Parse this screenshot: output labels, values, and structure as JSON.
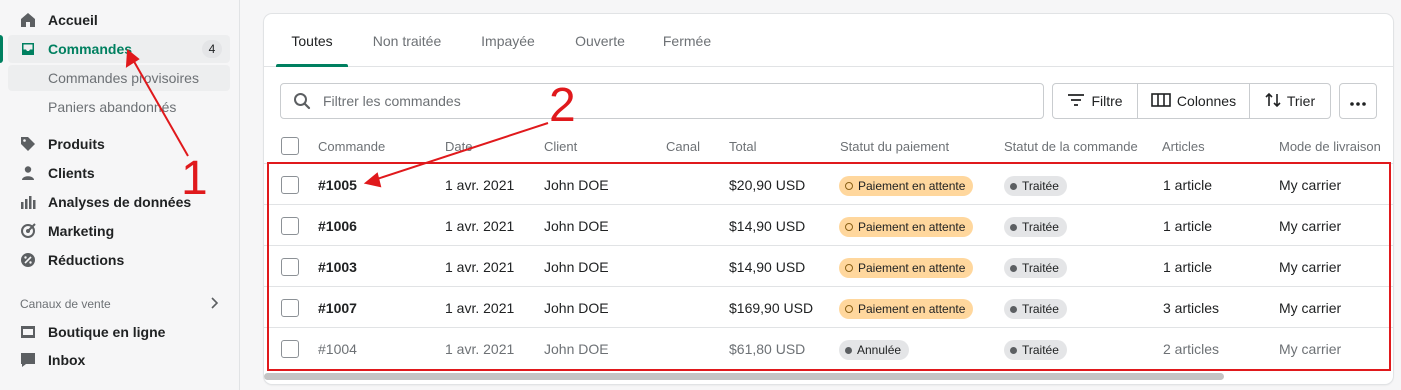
{
  "sidebar": {
    "items": [
      {
        "label": "Accueil",
        "icon": "home-icon"
      },
      {
        "label": "Commandes",
        "icon": "inbox-tray-icon",
        "badge": "4",
        "active": true
      },
      {
        "label": "Produits",
        "icon": "tag-icon"
      },
      {
        "label": "Clients",
        "icon": "person-icon"
      },
      {
        "label": "Analyses de données",
        "icon": "bar-chart-icon"
      },
      {
        "label": "Marketing",
        "icon": "target-icon"
      },
      {
        "label": "Réductions",
        "icon": "discount-icon"
      }
    ],
    "subitems": [
      "Commandes provisoires",
      "Paniers abandonnés"
    ],
    "sales_channels_title": "Canaux de vente",
    "channels": [
      {
        "label": "Boutique en ligne",
        "icon": "store-icon"
      },
      {
        "label": "Inbox",
        "icon": "chat-icon"
      }
    ]
  },
  "tabs": [
    "Toutes",
    "Non traitée",
    "Impayée",
    "Ouverte",
    "Fermée"
  ],
  "search": {
    "placeholder": "Filtrer les commandes"
  },
  "toolbar": {
    "filter": "Filtre",
    "columns": "Colonnes",
    "sort": "Trier"
  },
  "columns": [
    "Commande",
    "Date",
    "Client",
    "Canal",
    "Total",
    "Statut du paiement",
    "Statut de la commande",
    "Articles",
    "Mode de livraison"
  ],
  "orders": [
    {
      "id": "#1005",
      "date": "1 avr. 2021",
      "client": "John DOE",
      "channel": "",
      "total": "$20,90 USD",
      "payment": "Paiement en attente",
      "status": "Traitée",
      "items": "1 article",
      "shipping": "My carrier"
    },
    {
      "id": "#1006",
      "date": "1 avr. 2021",
      "client": "John DOE",
      "channel": "",
      "total": "$14,90 USD",
      "payment": "Paiement en attente",
      "status": "Traitée",
      "items": "1 article",
      "shipping": "My carrier"
    },
    {
      "id": "#1003",
      "date": "1 avr. 2021",
      "client": "John DOE",
      "channel": "",
      "total": "$14,90 USD",
      "payment": "Paiement en attente",
      "status": "Traitée",
      "items": "1 article",
      "shipping": "My carrier"
    },
    {
      "id": "#1007",
      "date": "1 avr. 2021",
      "client": "John DOE",
      "channel": "",
      "total": "$169,90 USD",
      "payment": "Paiement en attente",
      "status": "Traitée",
      "items": "3 articles",
      "shipping": "My carrier"
    },
    {
      "id": "#1004",
      "date": "1 avr. 2021",
      "client": "John DOE",
      "channel": "",
      "total": "$61,80 USD",
      "payment": "Annulée",
      "status": "Traitée",
      "items": "2 articles",
      "shipping": "My carrier"
    }
  ],
  "annotations": {
    "one": "1",
    "two": "2"
  },
  "colors": {
    "accent": "#008060",
    "annotation": "#e0191c",
    "payment_pending": "#ffd79d"
  }
}
